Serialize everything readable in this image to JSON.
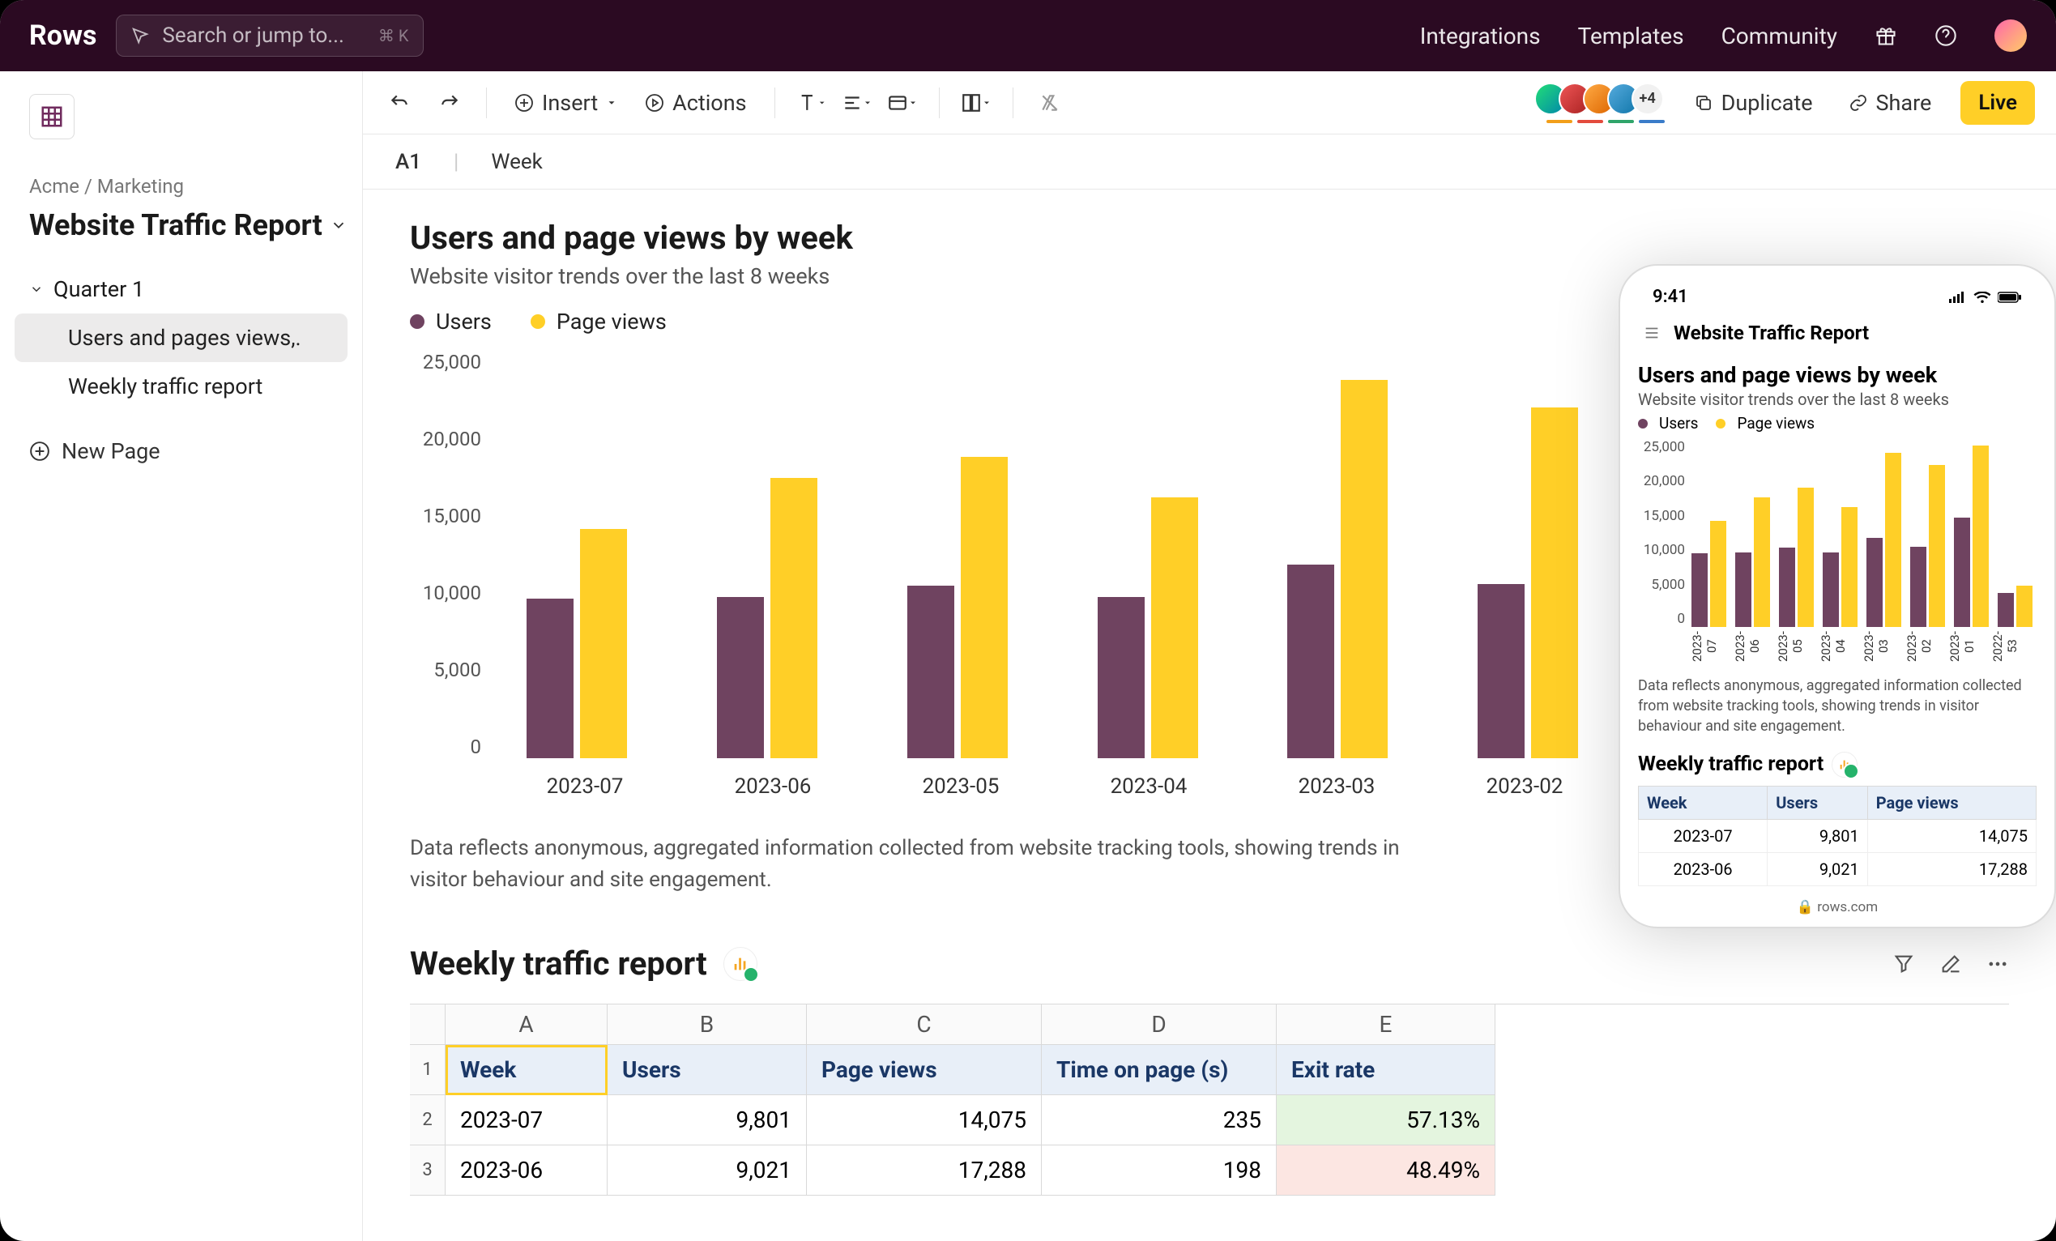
{
  "top": {
    "logo": "Rows",
    "search_placeholder": "Search or jump to...",
    "search_kbd": "⌘ K",
    "nav": [
      "Integrations",
      "Templates",
      "Community"
    ],
    "more_faces": "+4"
  },
  "sidebar": {
    "breadcrumb": "Acme / Marketing",
    "doc_title": "Website Traffic Report",
    "section": "Quarter 1",
    "items": [
      "Users and pages views,.",
      "Weekly traffic report"
    ],
    "new_page": "New Page"
  },
  "toolbar": {
    "insert": "Insert",
    "actions": "Actions",
    "duplicate": "Duplicate",
    "share": "Share",
    "live": "Live"
  },
  "cellbar": {
    "ref": "A1",
    "val": "Week"
  },
  "chart_data": {
    "type": "bar",
    "title": "Users and page views by week",
    "subtitle": "Website visitor trends over the last 8 weeks",
    "legend": [
      "Users",
      "Page views"
    ],
    "categories": [
      "2023-07",
      "2023-06",
      "2023-05",
      "2023-04",
      "2023-03",
      "2023-02",
      "2023-01",
      "2022-53"
    ],
    "series": [
      {
        "name": "Users",
        "color": "#6f4360",
        "values": [
          9801,
          9900,
          10600,
          9900,
          11900,
          10700,
          14600,
          4500
        ]
      },
      {
        "name": "Page views",
        "color": "#ffcf27",
        "values": [
          14075,
          17200,
          18500,
          16000,
          23200,
          21500,
          24100,
          5500
        ]
      }
    ],
    "ylabel": "",
    "xlabel": "",
    "ylim": [
      0,
      25000
    ],
    "yticks": [
      "25,000",
      "20,000",
      "15,000",
      "10,000",
      "5,000",
      "0"
    ],
    "caption": "Data reflects anonymous, aggregated information collected from website tracking tools, showing trends in visitor behaviour and site engagement."
  },
  "table": {
    "title": "Weekly traffic report",
    "cols": [
      "A",
      "B",
      "C",
      "D",
      "E"
    ],
    "headers": [
      "Week",
      "Users",
      "Page views",
      "Time on page (s)",
      "Exit rate"
    ],
    "rows": [
      {
        "n": "2",
        "cells": [
          "2023-07",
          "9,801",
          "14,075",
          "235",
          "57.13%"
        ],
        "exit_class": "good"
      },
      {
        "n": "3",
        "cells": [
          "2023-06",
          "9,021",
          "17,288",
          "198",
          "48.49%"
        ],
        "exit_class": "bad"
      }
    ]
  },
  "phone": {
    "time": "9:41",
    "title": "Website Traffic Report",
    "h2": "Weekly traffic report",
    "headers": [
      "Week",
      "Users",
      "Page views"
    ],
    "rows": [
      [
        "2023-07",
        "9,801",
        "14,075"
      ],
      [
        "2023-06",
        "9,021",
        "17,288"
      ]
    ],
    "url": "🔒 rows.com"
  }
}
